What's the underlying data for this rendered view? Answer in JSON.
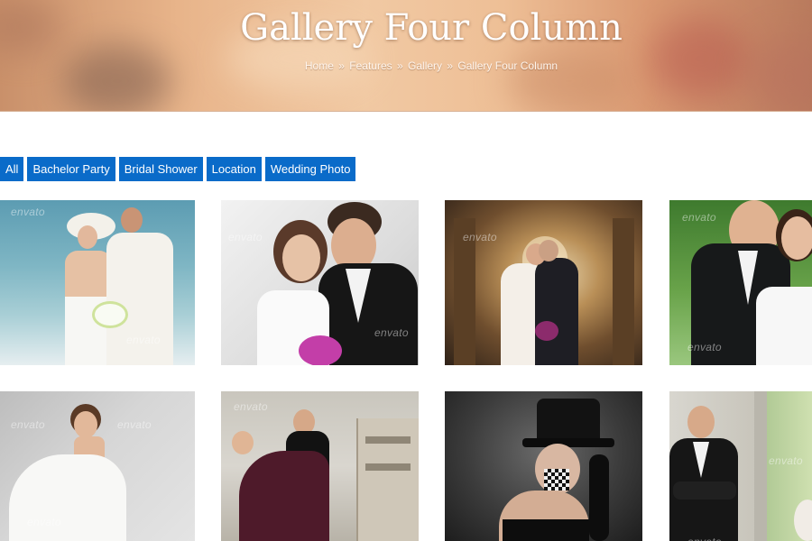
{
  "hero": {
    "title": "Gallery Four Column",
    "breadcrumb": [
      "Home",
      "Features",
      "Gallery",
      "Gallery Four Column"
    ],
    "separator": "»"
  },
  "filters": [
    "All",
    "Bachelor Party",
    "Bridal Shower",
    "Location",
    "Wedding Photo"
  ],
  "colors": {
    "accent": "#0a6bc9"
  },
  "gallery": {
    "watermark": "envato",
    "items": [
      {
        "scene": "beach-couple"
      },
      {
        "scene": "studio-couple-bouquet"
      },
      {
        "scene": "church-kiss"
      },
      {
        "scene": "smiling-couple-suit"
      },
      {
        "scene": "bride-seated-white-dress"
      },
      {
        "scene": "dancing-couple-street"
      },
      {
        "scene": "woman-top-hat"
      },
      {
        "scene": "groom-arms-crossed"
      }
    ]
  }
}
